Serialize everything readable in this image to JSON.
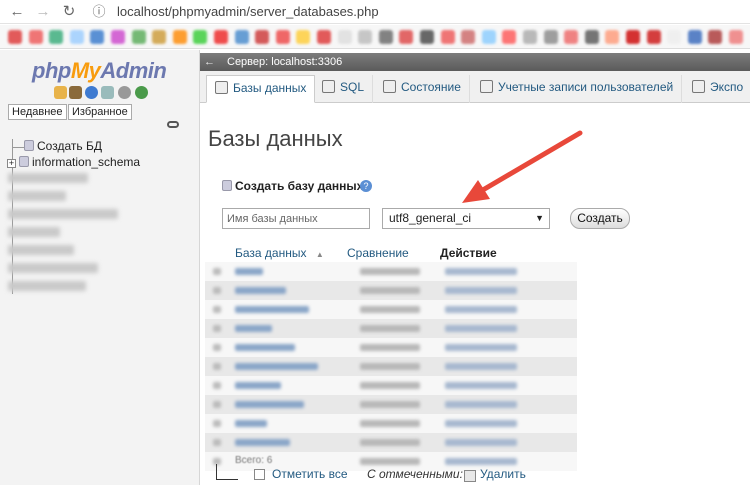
{
  "browser": {
    "url": "localhost/phpmyadmin/server_databases.php",
    "bookmark_colors": [
      "#d33",
      "#e55",
      "#3a7",
      "#9cf",
      "#37c",
      "#c4c",
      "#5a5",
      "#c93",
      "#f80",
      "#3c3",
      "#e22",
      "#48c",
      "#c33",
      "#e44",
      "#fc3",
      "#d33",
      "#ddd",
      "#bbb",
      "#666",
      "#d44",
      "#444",
      "#e55",
      "#c66",
      "#8cf",
      "#f55",
      "#aaa",
      "#888",
      "#e66",
      "#555",
      "#f97",
      "#c00",
      "#c11",
      "#eee",
      "#36b",
      "#a33",
      "#e77"
    ]
  },
  "sidebar": {
    "logo_php": "php",
    "logo_my": "My",
    "logo_admin": "Admin",
    "tabs": [
      "Недавнее",
      "Избранное"
    ],
    "create_db": "Создать БД",
    "databases": [
      "information_schema"
    ],
    "blurred_widths": [
      50,
      28,
      80,
      22,
      36,
      60,
      48
    ]
  },
  "topbar": {
    "server": "Сервер: localhost:3306"
  },
  "tabs": [
    {
      "label": "Базы данных",
      "active": true
    },
    {
      "label": "SQL",
      "active": false
    },
    {
      "label": "Состояние",
      "active": false
    },
    {
      "label": "Учетные записи пользователей",
      "active": false
    },
    {
      "label": "Экспо",
      "active": false
    }
  ],
  "main": {
    "title": "Базы данных",
    "create_label": "Создать базу данных",
    "help": "?",
    "dbname_placeholder": "Имя базы данных",
    "collation": "utf8_general_ci",
    "create_button": "Создать"
  },
  "table": {
    "headers": [
      "База данных",
      "Сравнение",
      "Действие"
    ],
    "sort_arrow": "▲",
    "row_count": 10,
    "row_labels": [
      "",
      "",
      "",
      "",
      "",
      "",
      "",
      "",
      "",
      "",
      "Всего: 6"
    ]
  },
  "footer": {
    "check_all": "Отметить все",
    "with_selected": "С отмеченными:",
    "delete": "Удалить"
  }
}
